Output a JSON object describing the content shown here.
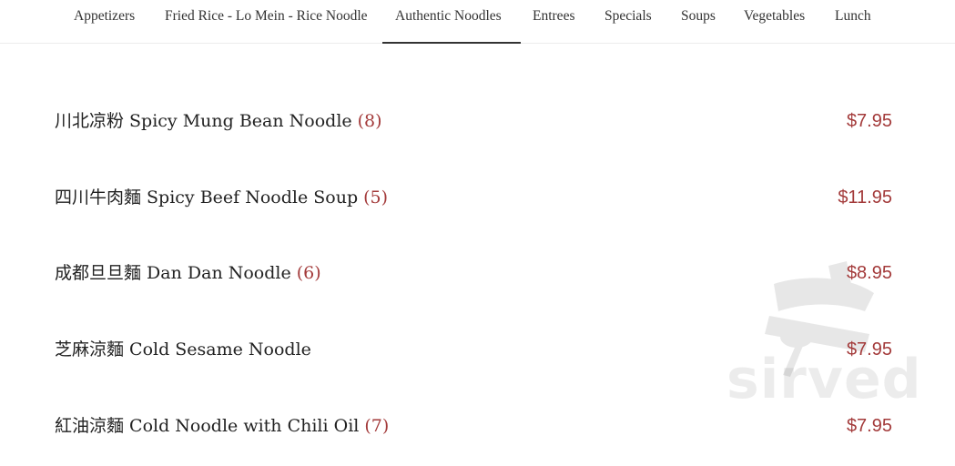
{
  "nav": {
    "tabs": [
      {
        "label": "Appetizers",
        "active": false
      },
      {
        "label": "Fried Rice - Lo Mein - Rice Noodle",
        "active": false
      },
      {
        "label": "Authentic Noodles",
        "active": true
      },
      {
        "label": "Entrees",
        "active": false
      },
      {
        "label": "Specials",
        "active": false
      },
      {
        "label": "Soups",
        "active": false
      },
      {
        "label": "Vegetables",
        "active": false
      },
      {
        "label": "Lunch",
        "active": false
      }
    ]
  },
  "menu": {
    "items": [
      {
        "name": "川北凉粉 Spicy Mung Bean Noodle",
        "spice": "(8)",
        "price": "$7.95"
      },
      {
        "name": "四川牛肉麵 Spicy Beef Noodle Soup",
        "spice": "(5)",
        "price": "$11.95"
      },
      {
        "name": "成都旦旦麵 Dan Dan Noodle",
        "spice": "(6)",
        "price": "$8.95"
      },
      {
        "name": "芝麻涼麵 Cold Sesame Noodle",
        "spice": "",
        "price": "$7.95"
      },
      {
        "name": "紅油涼麵 Cold Noodle with Chili Oil",
        "spice": "(7)",
        "price": "$7.95"
      }
    ]
  },
  "watermark": {
    "text": "sirved",
    "icon": "utensils-icon"
  },
  "colors": {
    "accent": "#a33a3a",
    "text": "#222222",
    "nav_text": "#333333"
  }
}
